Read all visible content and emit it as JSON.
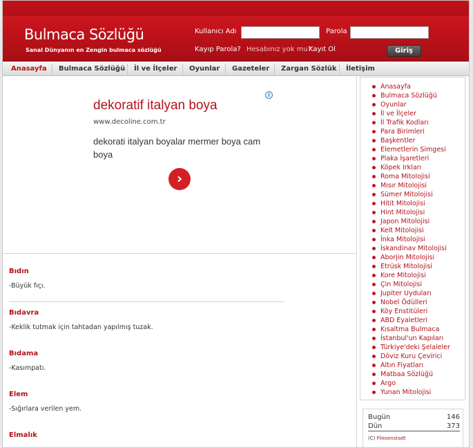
{
  "header": {
    "logo_title": "Bulmaca Sözlüğü",
    "logo_subtitle": "Sanal Dünyanın en Zengin bulmaca sözlüğü",
    "username_label": "Kullanıcı Adı",
    "password_label": "Parola",
    "username_value": "",
    "password_value": "",
    "forgot_link": "Kayıp Parola?",
    "no_account_text": "Hesabınız yok mu?",
    "register_link": "Kayıt Ol",
    "login_button": "Giriş"
  },
  "nav": {
    "items": [
      {
        "label": "Anasayfa",
        "active": true
      },
      {
        "label": "Bulmaca Sözlüğü"
      },
      {
        "label": "İl ve İlçeler"
      },
      {
        "label": "Oyunlar"
      },
      {
        "label": "Gazeteler"
      },
      {
        "label": "Zargan Sözlük"
      },
      {
        "label": "İletişim"
      }
    ]
  },
  "ad": {
    "info_icon": "i",
    "title": "dekoratif italyan boya",
    "url": "www.decoline.com.tr",
    "description": "dekorati italyan boyalar mermer boya cam boya",
    "arrow_icon": "›"
  },
  "entries": [
    {
      "title": "Bıdın",
      "definition": "-Büyük fıçı."
    },
    {
      "title": "Bıdavra",
      "definition": "-Keklik tutmak için tahtadan yapılmış tuzak."
    },
    {
      "title": "Bıdama",
      "definition": "-Kasımpatı."
    },
    {
      "title": "Elem",
      "definition": "-Sığırlara verilen yem."
    },
    {
      "title": "Elmalık",
      "definition": ""
    }
  ],
  "sidebar": {
    "items": [
      "Anasayfa",
      "Bulmaca Sözlüğü",
      "Oyunlar",
      "İl ve İlçeler",
      "İl Trafik Kodları",
      "Para Birimleri",
      "Başkentler",
      "Elemetlerin Simgesi",
      "Plaka İşaretleri",
      "Köpek Irkları",
      "Roma Mitolojisi",
      "Mısır Mitolojisi",
      "Sümer Mitolojisi",
      "Hitit Mitolojisi",
      "Hint Mitolojisi",
      "Japon Mitolojisi",
      "Kelt Mitolojisi",
      "İnka Mitolojisi",
      "İskandinav Mitolojisi",
      "Aborjin Mitolojisi",
      "Etrüsk Mitolojisi",
      "Kore Mitolojisi",
      "Çin Mitolojisi",
      "Jupiter Uyduları",
      "Nobel Ödülleri",
      "Köy Enstitüleri",
      "ABD Eyaletleri",
      "Kısaltma Bulmaca",
      "İstanbul'un Kapıları",
      "Türkiye'deki Şelaleler",
      "Döviz Kuru Çevirici",
      "Altın Fiyatları",
      "Matbaa Sözlüğü",
      "Argo",
      "Yunan Mitolojisi"
    ]
  },
  "stats": {
    "today_label": "Bugün",
    "today_value": "146",
    "yesterday_label": "Dün",
    "yesterday_value": "373",
    "credit_prefix": "(C)",
    "credit_name": "Filesenstadt"
  }
}
